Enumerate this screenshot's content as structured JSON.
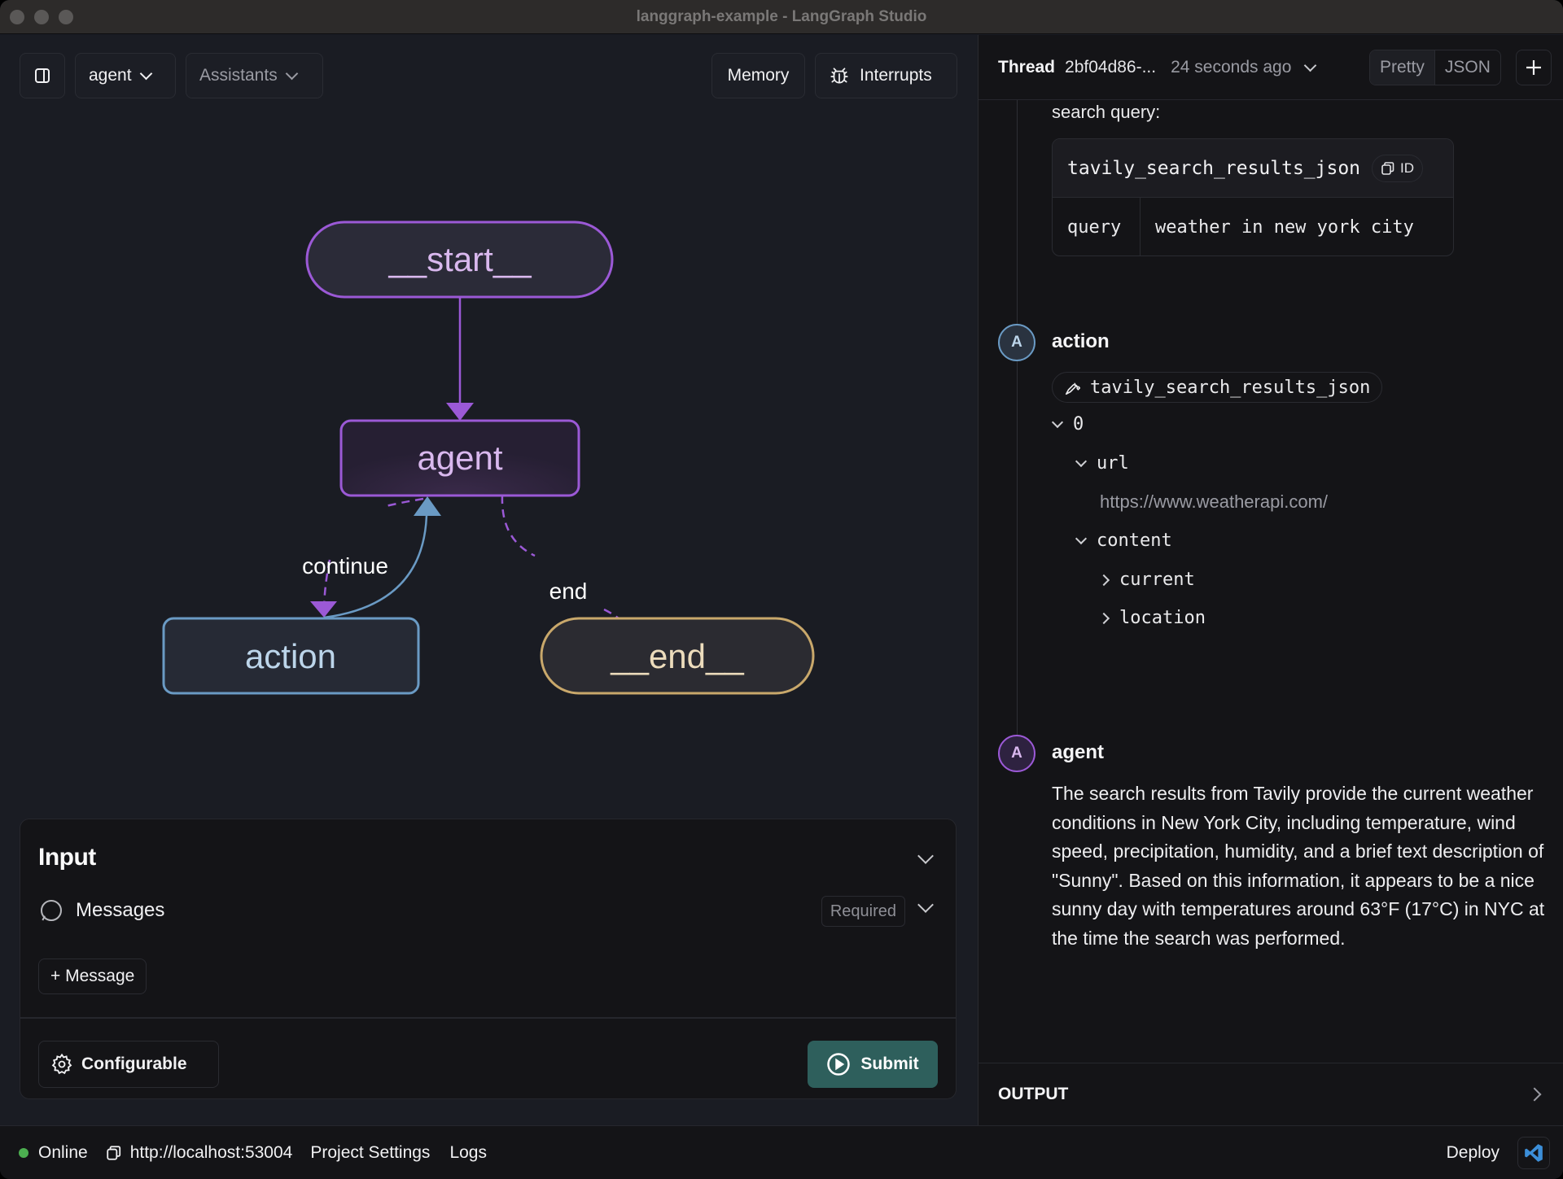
{
  "window": {
    "title": "langgraph-example - LangGraph Studio"
  },
  "toolbar": {
    "graph_selector": "agent",
    "assistants_label": "Assistants",
    "memory_label": "Memory",
    "interrupts_label": "Interrupts"
  },
  "graph": {
    "nodes": [
      {
        "id": "start",
        "label": "__start__",
        "color": "#9b59d6",
        "text_color": "#d9b8ee"
      },
      {
        "id": "agent",
        "label": "agent",
        "color": "#9b59d6",
        "text_color": "#d9b8ee"
      },
      {
        "id": "action",
        "label": "action",
        "color": "#6a9ac4",
        "text_color": "#bcd5ea"
      },
      {
        "id": "end",
        "label": "__end__",
        "color": "#c9a86b",
        "text_color": "#ecdcbc"
      }
    ],
    "edges": [
      {
        "from": "start",
        "to": "agent",
        "label": "",
        "style": "solid"
      },
      {
        "from": "agent",
        "to": "action",
        "label": "continue",
        "style": "dashed"
      },
      {
        "from": "action",
        "to": "agent",
        "label": "",
        "style": "solid"
      },
      {
        "from": "agent",
        "to": "end",
        "label": "end",
        "style": "dashed"
      }
    ]
  },
  "input": {
    "title": "Input",
    "messages_label": "Messages",
    "required_label": "Required",
    "add_message_label": "+ Message",
    "configurable_label": "Configurable",
    "submit_label": "Submit"
  },
  "status": {
    "online_label": "Online",
    "url": "http://localhost:53004",
    "project_settings_label": "Project Settings",
    "logs_label": "Logs",
    "deploy_label": "Deploy"
  },
  "thread": {
    "label": "Thread",
    "id": "2bf04d86-...",
    "time": "24 seconds ago",
    "view_modes": [
      "Pretty",
      "JSON"
    ],
    "active_view": "Pretty",
    "search_query_label": "search query:",
    "tool_call": {
      "name": "tavily_search_results_json",
      "id_badge": "ID",
      "args": [
        {
          "key": "query",
          "value": "weather in new york city"
        }
      ]
    },
    "action_step": {
      "avatar": "A",
      "name": "action",
      "tool_name": "tavily_search_results_json",
      "tree": {
        "index": "0",
        "url_key": "url",
        "url_value": "https://www.weatherapi.com/",
        "content_key": "content",
        "content_children": [
          "current",
          "location"
        ]
      }
    },
    "agent_step": {
      "avatar": "A",
      "name": "agent",
      "message": "The search results from Tavily provide the current weather conditions in New York City, including temperature, wind speed, precipitation, humidity, and a brief text description of \"Sunny\". Based on this information, it appears to be a nice sunny day with temperatures around 63°F (17°C) in NYC at the time the search was performed."
    },
    "output_label": "OUTPUT"
  },
  "colors": {
    "submit": "#2e5f5c",
    "online": "#4caf50",
    "agent_accent": "#9b59d6",
    "action_accent": "#6a9ac4",
    "end_accent": "#c9a86b"
  }
}
